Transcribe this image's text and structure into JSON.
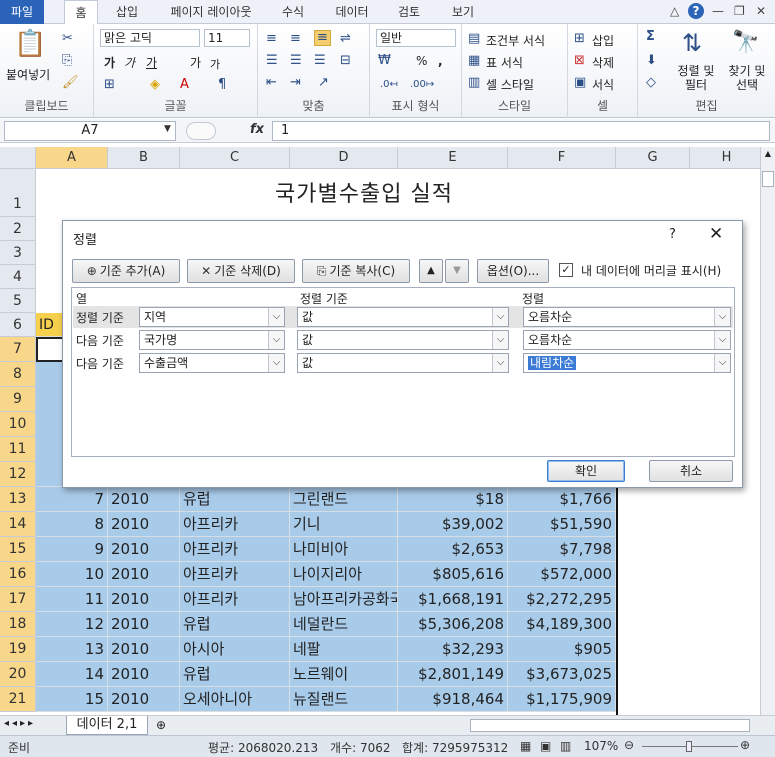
{
  "menu": {
    "file": "파일",
    "tabs": [
      "홈",
      "삽입",
      "페이지 레이아웃",
      "수식",
      "데이터",
      "검토",
      "보기"
    ]
  },
  "ribbon": {
    "clipboard": {
      "paste": "붙여넣기",
      "label": "클립보드"
    },
    "font": {
      "name": "맑은 고딕",
      "size": "11",
      "bold": "가",
      "italic": "가",
      "underline": "가",
      "grow": "가",
      "shrink": "가",
      "label": "글꼴"
    },
    "alignment": {
      "label": "맞춤"
    },
    "number": {
      "format": "일반",
      "percent": "%",
      "comma": ",",
      "label": "표시 형식"
    },
    "styles": {
      "conditional": "조건부 서식",
      "table": "표 서식",
      "cell": "셀 스타일",
      "label": "스타일"
    },
    "cells": {
      "insert": "삽입",
      "delete": "삭제",
      "format": "서식",
      "label": "셀"
    },
    "editing": {
      "sort": "정렬 및 필터",
      "find": "찾기 및 선택",
      "label": "편집"
    }
  },
  "formula_bar": {
    "name_box": "A7",
    "fx": "fx",
    "value": "1"
  },
  "grid": {
    "columns": [
      "A",
      "B",
      "C",
      "D",
      "E",
      "F",
      "G",
      "H"
    ],
    "title": "국가별수출입 실적",
    "row6_id": "ID",
    "rows": [
      {
        "r": "13",
        "id": "7",
        "year": "2010",
        "region": "유럽",
        "country": "그린랜드",
        "imp": "$18",
        "exp": "$1,766"
      },
      {
        "r": "14",
        "id": "8",
        "year": "2010",
        "region": "아프리카",
        "country": "기니",
        "imp": "$39,002",
        "exp": "$51,590"
      },
      {
        "r": "15",
        "id": "9",
        "year": "2010",
        "region": "아프리카",
        "country": "나미비아",
        "imp": "$2,653",
        "exp": "$7,798"
      },
      {
        "r": "16",
        "id": "10",
        "year": "2010",
        "region": "아프리카",
        "country": "나이지리아",
        "imp": "$805,616",
        "exp": "$572,000"
      },
      {
        "r": "17",
        "id": "11",
        "year": "2010",
        "region": "아프리카",
        "country": "남아프리카공화국",
        "imp": "$1,668,191",
        "exp": "$2,272,295"
      },
      {
        "r": "18",
        "id": "12",
        "year": "2010",
        "region": "유럽",
        "country": "네덜란드",
        "imp": "$5,306,208",
        "exp": "$4,189,300"
      },
      {
        "r": "19",
        "id": "13",
        "year": "2010",
        "region": "아시아",
        "country": "네팔",
        "imp": "$32,293",
        "exp": "$905"
      },
      {
        "r": "20",
        "id": "14",
        "year": "2010",
        "region": "유럽",
        "country": "노르웨이",
        "imp": "$2,801,149",
        "exp": "$3,673,025"
      },
      {
        "r": "21",
        "id": "15",
        "year": "2010",
        "region": "오세아니아",
        "country": "뉴질랜드",
        "imp": "$918,464",
        "exp": "$1,175,909"
      }
    ]
  },
  "sheet_tab": "데이터 2,1",
  "status": {
    "ready": "준비",
    "average": "평균: 2068020.213",
    "count": "개수: 7062",
    "sum": "합계: 7295975312",
    "zoom": "107%"
  },
  "dialog": {
    "title": "정렬",
    "help": "?",
    "add_level": "기준 추가(A)",
    "delete_level": "기준 삭제(D)",
    "copy_level": "기준 복사(C)",
    "options": "옵션(O)...",
    "header_checkbox": "내 데이터에 머리글 표시(H)",
    "header_checked": true,
    "col_header": "열",
    "sorton_header": "정렬 기준",
    "order_header": "정렬",
    "levels": [
      {
        "label": "정렬 기준",
        "column": "지역",
        "sort_on": "값",
        "order": "오름차순"
      },
      {
        "label": "다음 기준",
        "column": "국가명",
        "sort_on": "값",
        "order": "오름차순"
      },
      {
        "label": "다음 기준",
        "column": "수출금액",
        "sort_on": "값",
        "order": "내림차순"
      }
    ],
    "ok": "확인",
    "cancel": "취소"
  }
}
